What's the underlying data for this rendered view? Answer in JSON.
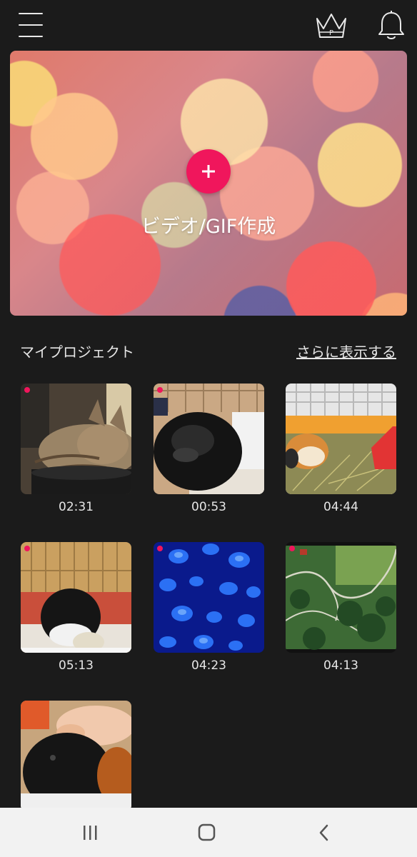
{
  "toolbar": {
    "menu_icon": "hamburger-menu-icon",
    "crown_icon": "premium-crown-icon",
    "crown_letter": "P",
    "bell_icon": "notification-bell-icon"
  },
  "hero": {
    "label": "ビデオ/GIF作成",
    "plus_icon": "plus-icon",
    "accent_color": "#f0165c"
  },
  "projects_section": {
    "title": "マイプロジェクト",
    "see_more": "さらに表示する"
  },
  "projects": [
    {
      "duration": "02:31",
      "thumbnail": "sleeping tabby cat",
      "new": true
    },
    {
      "duration": "00:53",
      "thumbnail": "black guinea pig",
      "new": true
    },
    {
      "duration": "04:44",
      "thumbnail": "guinea pig in cage",
      "new": false
    },
    {
      "duration": "05:13",
      "thumbnail": "black guinea pig eating",
      "new": true
    },
    {
      "duration": "04:23",
      "thumbnail": "blue jellyfish",
      "new": true
    },
    {
      "duration": "04:13",
      "thumbnail": "aerial mountain road",
      "new": true
    },
    {
      "duration": "",
      "thumbnail": "hand petting guinea pig",
      "new": false
    }
  ],
  "system_nav": {
    "recents_icon": "recent-apps-icon",
    "home_icon": "home-icon",
    "back_icon": "back-chevron-icon"
  }
}
